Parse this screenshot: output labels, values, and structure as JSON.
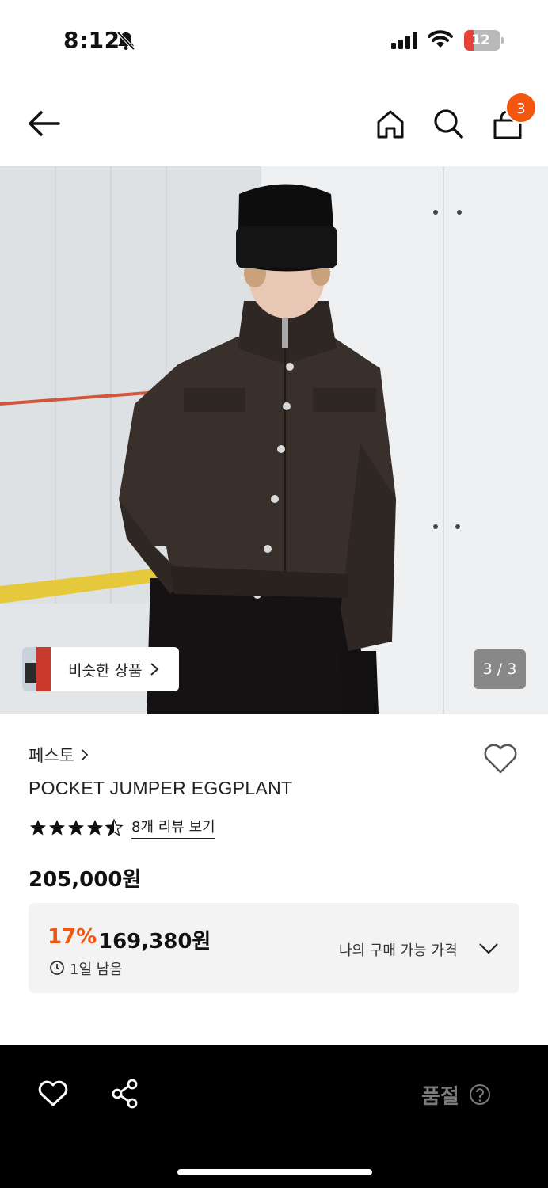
{
  "status_bar": {
    "time": "8:12",
    "battery": "12",
    "icons": [
      "bell-slash-icon",
      "signal-icon",
      "wifi-icon",
      "battery-icon"
    ]
  },
  "header": {
    "cart_count": "3",
    "icons": [
      "back-arrow-icon",
      "home-icon",
      "search-icon",
      "cart-icon"
    ]
  },
  "gallery": {
    "similar_label": "비슷한 상품",
    "page_counter": "3 / 3"
  },
  "product": {
    "brand": "페스토",
    "name": "POCKET JUMPER EGGPLANT",
    "rating": 4.5,
    "review_link": "8개 리뷰 보기",
    "price": "205,000원"
  },
  "price_box": {
    "discount": "17%",
    "sale_price": "169,380원",
    "remaining": "1일 남음",
    "my_price_label": "나의 구매 가능 가격"
  },
  "bottom_bar": {
    "status": "품절"
  },
  "colors": {
    "accent": "#f2560f",
    "bottom_bar": "#000000",
    "soldout_text": "#7a7a7a"
  }
}
